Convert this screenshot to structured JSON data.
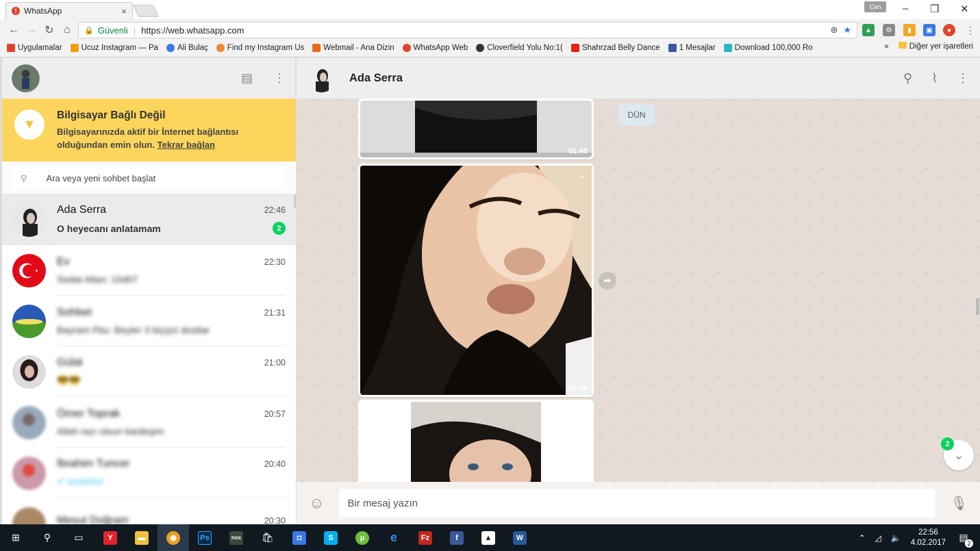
{
  "browser": {
    "tab_title": "WhatsApp",
    "tab_close": "×",
    "profile": "Can",
    "minimize": "–",
    "restore": "❐",
    "close": "✕",
    "secure_label": "Güvenli",
    "url": "https://web.whatsapp.com",
    "bookmarks": [
      {
        "label": "Uygulamalar",
        "color": "#e0432d"
      },
      {
        "label": "Ucuz Instagram — Pa",
        "color": "#f39c12"
      },
      {
        "label": "Ali Bulaç",
        "color": "#3b78e7"
      },
      {
        "label": "Find my Instagram Us",
        "color": "#f0882e"
      },
      {
        "label": "Webmail - Ana Dizin",
        "color": "#e86a1c"
      },
      {
        "label": "WhatsApp Web",
        "color": "#e0432d"
      },
      {
        "label": "Cloverfield Yolu No:1(",
        "color": "#333333"
      },
      {
        "label": "Shahrzad Belly Dance",
        "color": "#e62117"
      },
      {
        "label": "1 Mesajlar",
        "color": "#3b5998"
      },
      {
        "label": "Download 100,000 Ro",
        "color": "#2bb5c5"
      }
    ],
    "bookmarks_more": "»",
    "other_bookmarks": "Diğer yer işaretleri"
  },
  "sidebar": {
    "warning_title": "Bilgisayar Bağlı Değil",
    "warning_text": "Bilgisayarınızda aktif bir İnternet bağlantısı olduğundan emin olun.",
    "warning_link": "Tekrar bağlan",
    "search_placeholder": "Ara veya yeni sohbet başlat",
    "chats": [
      {
        "name": "Ada Serra",
        "time": "22:46",
        "preview": "O heyecanı anlatamam",
        "unread": "2",
        "active": true
      },
      {
        "name": "Ev",
        "time": "22:30",
        "preview": "Sedat Altan: 10d07"
      },
      {
        "name": "Sohbet",
        "time": "21:31",
        "preview": "Bayram Fbu: Beyler 3 biçiyiz dostlar"
      },
      {
        "name": "Gülal",
        "time": "21:00",
        "preview": "😎😎"
      },
      {
        "name": "Ömer Toprak",
        "time": "20:57",
        "preview": "Allah razı olsun kardeşim"
      },
      {
        "name": "İbrahim Tuncer",
        "time": "20:40",
        "preview": "✔ tesekkür"
      },
      {
        "name": "Mesut Doğram",
        "time": "20:30",
        "preview": ""
      }
    ]
  },
  "chat": {
    "contact_name": "Ada Serra",
    "day_label": "DÜN",
    "media": [
      {
        "duration": "01:48"
      },
      {
        "duration": "01:48"
      },
      {
        "duration": ""
      }
    ],
    "scroll_unread": "2",
    "compose_placeholder": "Bir mesaj yazın"
  },
  "taskbar": {
    "time": "22:56",
    "date": "4.02.2017",
    "notifications": "2"
  }
}
